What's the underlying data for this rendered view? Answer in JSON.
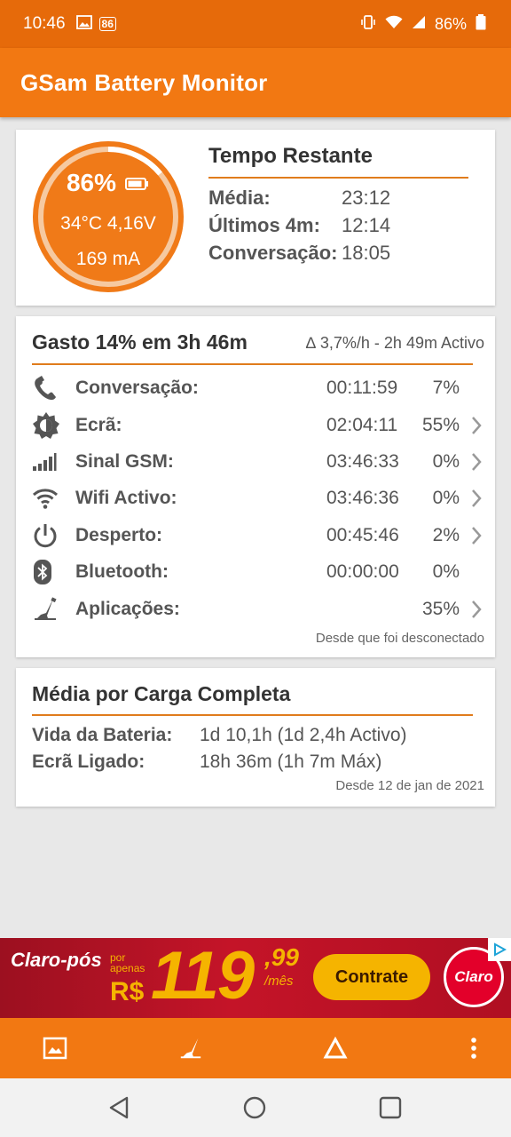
{
  "status_bar": {
    "time": "10:46",
    "badge": "86",
    "battery": "86%",
    "icons": [
      "image-icon",
      "vibrate-icon",
      "wifi-icon",
      "signal-icon",
      "battery-icon"
    ]
  },
  "app_bar": {
    "title": "GSam Battery Monitor"
  },
  "battery_gauge": {
    "percent": "86%",
    "level": 0.86,
    "temp_voltage": "34°C  4,16V",
    "current": "169 mA"
  },
  "time_remaining": {
    "title": "Tempo Restante",
    "rows": [
      {
        "label": "Média:",
        "value": "23:12"
      },
      {
        "label": "Últimos 4m:",
        "value": "12:14"
      },
      {
        "label": "Conversação:",
        "value": "18:05"
      }
    ]
  },
  "usage": {
    "title": "Gasto 14% em 3h 46m",
    "subtitle": "∆ 3,7%/h - 2h 49m Activo",
    "rows": [
      {
        "icon": "phone-icon",
        "label": "Conversação:",
        "time": "00:11:59",
        "pct": "7%",
        "chevron": false
      },
      {
        "icon": "screen-brightness-icon",
        "label": "Ecrã:",
        "time": "02:04:11",
        "pct": "55%",
        "chevron": true
      },
      {
        "icon": "signal-bars-icon",
        "label": "Sinal GSM:",
        "time": "03:46:33",
        "pct": "0%",
        "chevron": true
      },
      {
        "icon": "wifi-icon",
        "label": "Wifi Activo:",
        "time": "03:46:36",
        "pct": "0%",
        "chevron": true
      },
      {
        "icon": "power-icon",
        "label": "Desperto:",
        "time": "00:45:46",
        "pct": "2%",
        "chevron": true
      },
      {
        "icon": "bluetooth-icon",
        "label": "Bluetooth:",
        "time": "00:00:00",
        "pct": "0%",
        "chevron": false
      },
      {
        "icon": "apps-icon",
        "label": "Aplicações:",
        "time": "",
        "pct": "35%",
        "chevron": true
      }
    ],
    "footer": "Desde que foi desconectado"
  },
  "full_charge": {
    "title": "Média por Carga Completa",
    "rows": [
      {
        "label": "Vida da Bateria:",
        "value": "1d 10,1h (1d 2,4h Activo)"
      },
      {
        "label": "Ecrã Ligado:",
        "value": "18h 36m (1h 7m Máx)"
      }
    ],
    "footer": "Desde 12 de jan de 2021"
  },
  "ad": {
    "brand": "Claro-pós",
    "por": "por",
    "apenas": "apenas",
    "currency": "R$",
    "price": "119",
    "cents": ",99",
    "per_month": "/mês",
    "cta": "Contrate",
    "logo": "Claro"
  },
  "colors": {
    "status_bar": "#e66a0a",
    "app_bar": "#f27812",
    "gauge": "#f07a18",
    "divider": "#e07c1c"
  }
}
